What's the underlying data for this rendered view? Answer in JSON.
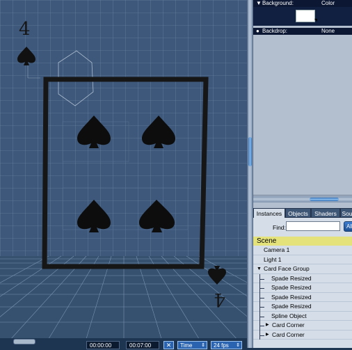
{
  "properties": {
    "background_label": "Background:",
    "background_value": "Color",
    "background_swatch_color": "#ffffff",
    "backdrop_label": "Backdrop:",
    "backdrop_value": "None"
  },
  "tabs": [
    {
      "label": "Instances",
      "active": true
    },
    {
      "label": "Objects",
      "active": false
    },
    {
      "label": "Shaders",
      "active": false
    },
    {
      "label": "Sou",
      "active": false
    }
  ],
  "find": {
    "label": "Find:",
    "value": "",
    "all_label": "All"
  },
  "scene": {
    "header": "Scene",
    "items": [
      {
        "label": "Camera 1"
      },
      {
        "label": "Light 1"
      },
      {
        "label": "Card Face Group"
      },
      {
        "label": "Spade Resized"
      },
      {
        "label": "Spade Resized"
      },
      {
        "label": "Spade Resized"
      },
      {
        "label": "Spade Resized"
      },
      {
        "label": "Spline Object"
      },
      {
        "label": "Card Corner"
      },
      {
        "label": "Card Corner"
      }
    ]
  },
  "timeline": {
    "current_time": "00:00:00",
    "end_time": "00:07:00",
    "mode_label": "Time",
    "fps_label": "24 fps"
  },
  "viewport": {
    "corner_rank_top": "4",
    "corner_rank_bottom": "4",
    "background_color": "#3d587a",
    "grid_color": "#7f98b8"
  },
  "colors": {
    "scene_header": "#e4e27a",
    "panel": "#b3bfce",
    "accent_blue": "#2a64b0"
  }
}
